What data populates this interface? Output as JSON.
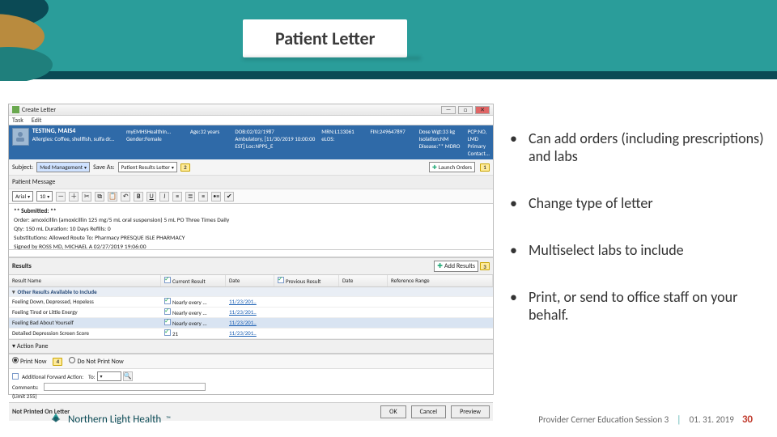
{
  "slide": {
    "title": "Patient Letter",
    "bullets": [
      "Can add orders (including prescriptions) and labs",
      "Change type of letter",
      "Multiselect labs to include",
      "Print, or send to office staff on your behalf."
    ]
  },
  "footer": {
    "org": "Northern Light Health",
    "source": "Provider Cerner Education Session 3",
    "date": "01. 31. 2019",
    "page": "30"
  },
  "app": {
    "window_title": "Create Letter",
    "menu": {
      "task": "Task",
      "edit": "Edit"
    },
    "window_buttons": {
      "min": "—",
      "max": "□",
      "close": "✕"
    },
    "banner": {
      "patient_name": "TESTING, MAIS4",
      "allergies": "Allergies: Coffee, shellfish, sulfa dr...",
      "portal": "myEMHSHealthIn...",
      "age": "Age:32 years",
      "gender": "Gender:Female",
      "dob": "DOB:02/02/1987",
      "loc": "Ambulatory, [11/30/2019 10:00:00 EST] Loc:NPPS_E",
      "mrn": "MRN:L133061",
      "fin": "FIN:249647897",
      "elos": "eLOS:",
      "dose_wt": "Dose Wgt:33 kg",
      "isolation": "Isolation:NM",
      "disease": "Disease:** MDRO",
      "pcp": "PCP:NO, LMD",
      "primary_contact": "Primary Contact..."
    },
    "subject_row": {
      "subject_label": "Subject:",
      "subject_value": "Med Management",
      "saveas_label": "Save As:",
      "saveas_value": "Patient Results Letter",
      "launch_orders": "Launch Orders"
    },
    "patient_message_label": "Patient Message",
    "toolbar": {
      "font": "Arial",
      "size": "10"
    },
    "editor": {
      "line1": "** Submitted: **",
      "line2": "Order: amoxicillin (amoxicillin 125 mg/5 mL oral suspension)  5 mL  PO  Three Times Daily",
      "line3": "Qty: 150 mL   Duration: 10 Days   Refills: 0",
      "line4": "Substitutions: Allowed   Route To: Pharmacy   PRESQUE ISLE PHARMACY",
      "line5": "Signed by ROSS MD, MICHAEL A  02/27/2019 19:06:00"
    },
    "results": {
      "section_label": "Results",
      "add_results": "Add Results",
      "headers": {
        "result_name": "Result Name",
        "current": "Current Result",
        "date1": "Date",
        "previous": "Previous Result",
        "date2": "Date",
        "ref": "Reference Range"
      },
      "category": "Other Results Available to Include",
      "rows": [
        {
          "name": "Feeling Down, Depressed, Hopeless",
          "current": "Nearly every ...",
          "date": "11/23/201.."
        },
        {
          "name": "Feeling Tired or Little Energy",
          "current": "Nearly every ...",
          "date": "11/23/201.."
        },
        {
          "name": "Feeling Bad About Yourself",
          "current": "Nearly every ...",
          "date": "11/23/201.."
        },
        {
          "name": "Detailed Depression Screen Score",
          "current": "21",
          "date": "11/23/201.."
        }
      ]
    },
    "action_pane": {
      "label": "Action Pane",
      "print_now": "Print Now",
      "do_not_print": "Do Not Print Now"
    },
    "extras": {
      "additional_label": "Additional Forward Action:",
      "to_label": "To:",
      "comments_label": "Comments:",
      "limit": "(Limit 255)"
    },
    "statusbar": {
      "text": "Not Printed On Letter",
      "ok": "OK",
      "cancel": "Cancel",
      "preview": "Preview"
    },
    "callouts": {
      "c1": "1",
      "c2": "2",
      "c3": "3",
      "c4": "4"
    }
  }
}
